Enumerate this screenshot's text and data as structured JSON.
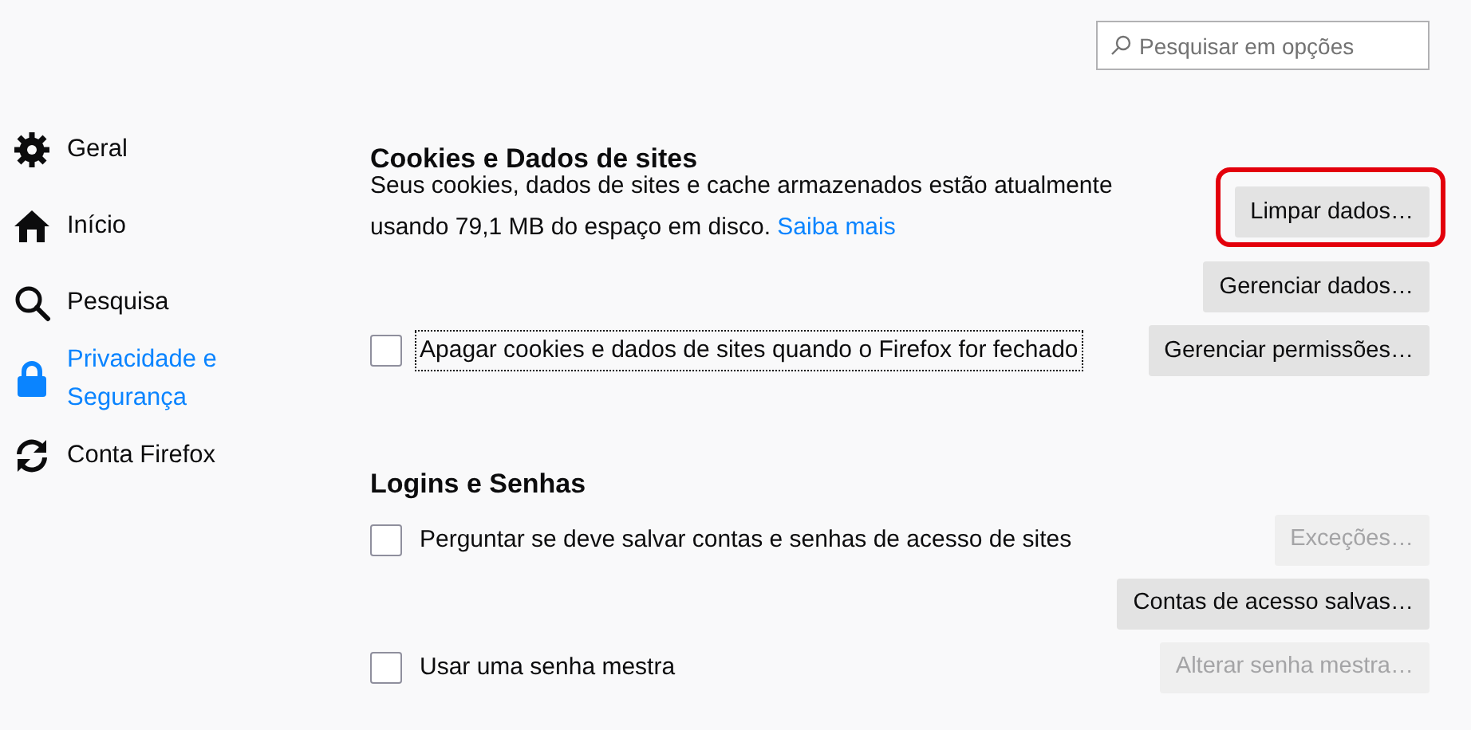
{
  "search": {
    "placeholder": "Pesquisar em opções"
  },
  "sidebar": {
    "items": [
      {
        "label": "Geral",
        "kind": "gear",
        "selected": false
      },
      {
        "label": "Início",
        "kind": "home",
        "selected": false
      },
      {
        "label": "Pesquisa",
        "kind": "search",
        "selected": false
      },
      {
        "label": "Privacidade e Segurança",
        "kind": "lock",
        "selected": true
      },
      {
        "label": "Conta Firefox",
        "kind": "sync",
        "selected": false
      }
    ]
  },
  "sections": [
    {
      "title": "Cookies e Dados de sites",
      "rows": [
        {
          "kind": "text",
          "description": "Seus cookies, dados de sites e cache armazenados estão atualmente usando 79,1 MB do espaço em disco.",
          "link": "Saiba mais",
          "button": {
            "label": "Limpar dados…",
            "disabled": false,
            "highlighted": true
          }
        },
        {
          "kind": "button",
          "button": {
            "label": "Gerenciar dados…",
            "disabled": false,
            "highlighted": false
          }
        },
        {
          "kind": "checkbox",
          "label": "Apagar cookies e dados de sites quando o Firefox for fechado",
          "checked": false,
          "focused": true,
          "button": {
            "label": "Gerenciar permissões…",
            "disabled": false,
            "highlighted": false
          }
        }
      ]
    },
    {
      "title": "Logins e Senhas",
      "rows": [
        {
          "kind": "checkbox",
          "label": "Perguntar se deve salvar contas e senhas de acesso de sites",
          "checked": false,
          "focused": false,
          "button": {
            "label": "Exceções…",
            "disabled": true,
            "highlighted": false
          }
        },
        {
          "kind": "button",
          "button": {
            "label": "Contas de acesso salvas…",
            "disabled": false,
            "highlighted": false
          }
        },
        {
          "kind": "checkbox",
          "label": "Usar uma senha mestra",
          "checked": false,
          "focused": false,
          "button": {
            "label": "Alterar senha mestra…",
            "disabled": true,
            "highlighted": false
          }
        }
      ]
    }
  ]
}
